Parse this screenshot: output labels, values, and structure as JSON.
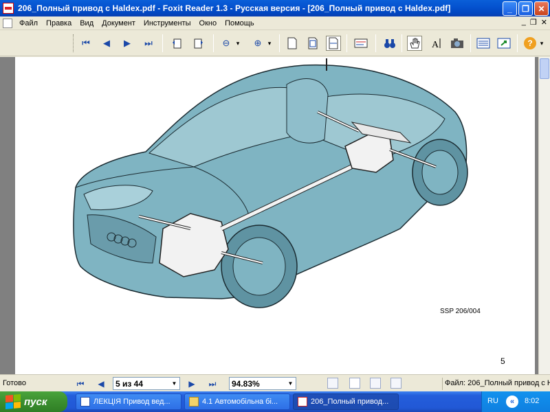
{
  "window": {
    "title": "206_Полный привод с Haldex.pdf - Foxit Reader 1.3 - Русская версия  - [206_Полный привод с Haldex.pdf]",
    "minimize": "_",
    "maximize": "❐",
    "close": "✕"
  },
  "menu": {
    "items": [
      "Файл",
      "Правка",
      "Вид",
      "Документ",
      "Инструменты",
      "Окно",
      "Помощь"
    ],
    "mdi": [
      "_",
      "❐",
      "✕"
    ]
  },
  "toolbar": {
    "first_page": "⏮",
    "prev_page": "◀",
    "next_page": "▶",
    "last_page": "⏭",
    "zoom_out": "⊖",
    "zoom_in": "⊕",
    "dropdown": "▾",
    "help": "?"
  },
  "document": {
    "caption": "SSP 206/004",
    "page_number": "5",
    "colors": {
      "car_body": "#7fb4c2",
      "car_outline": "#1a2a30"
    }
  },
  "status": {
    "ready": "Готово",
    "page_field": "5 из 44",
    "zoom_field": "94.83%",
    "file": "Файл: 206_Полный привод с Н"
  },
  "taskbar": {
    "start": "пуск",
    "tasks": [
      {
        "label": "ЛЕКЦІЯ Привод вед..."
      },
      {
        "label": "4.1 Автомобільна бі..."
      },
      {
        "label": "206_Полный привод..."
      }
    ],
    "lang": "RU",
    "time": "8:02"
  }
}
